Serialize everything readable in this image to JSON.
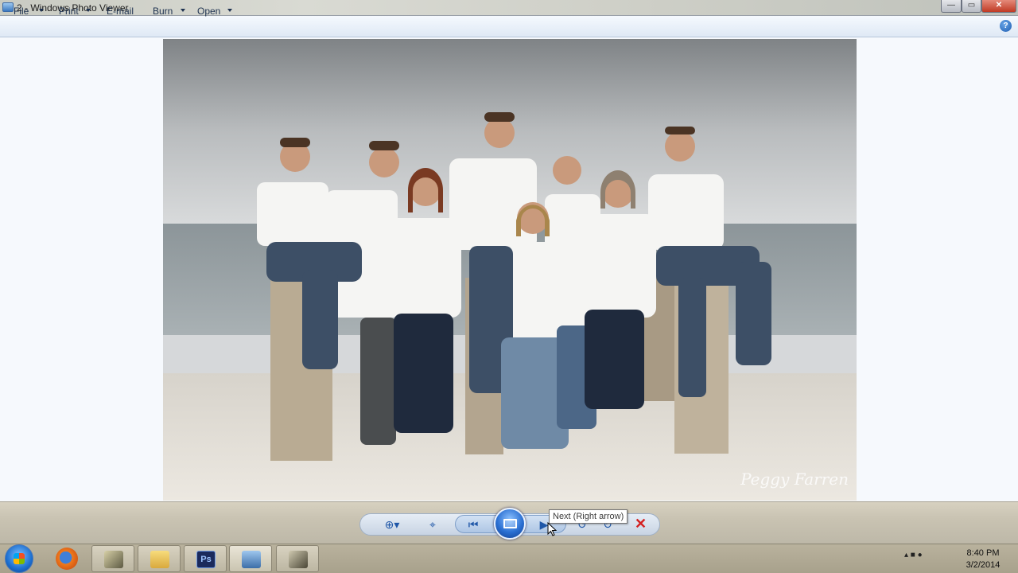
{
  "window": {
    "title": "2 - Windows Photo Viewer",
    "minimize_glyph": "—",
    "maximize_glyph": "▭",
    "close_glyph": "✕"
  },
  "menu": {
    "items": [
      {
        "label": "File"
      },
      {
        "label": "Print"
      },
      {
        "label": "E-mail"
      },
      {
        "label": "Burn"
      },
      {
        "label": "Open"
      }
    ],
    "help_glyph": "?"
  },
  "photo": {
    "watermark": "Peggy Farren"
  },
  "controls": {
    "zoom_icon": "zoom-icon",
    "actual_size_icon": "fit-window-icon",
    "previous_icon": "previous-icon",
    "slideshow_icon": "slideshow-icon",
    "next_icon": "next-icon",
    "rotate_ccw_icon": "rotate-counterclockwise-icon",
    "rotate_cw_icon": "rotate-clockwise-icon",
    "delete_glyph": "✕",
    "tooltip": "Next (Right arrow)"
  },
  "taskbar": {
    "apps": [
      {
        "name": "firefox"
      },
      {
        "name": "app-1"
      },
      {
        "name": "file-explorer"
      },
      {
        "name": "photoshop",
        "label": "Ps"
      },
      {
        "name": "photo-viewer"
      },
      {
        "name": "app-5"
      }
    ],
    "clock_time": "8:40 PM",
    "clock_date": "3/2/2014"
  },
  "colors": {
    "accent": "#1f57a8",
    "delete": "#d42020"
  }
}
